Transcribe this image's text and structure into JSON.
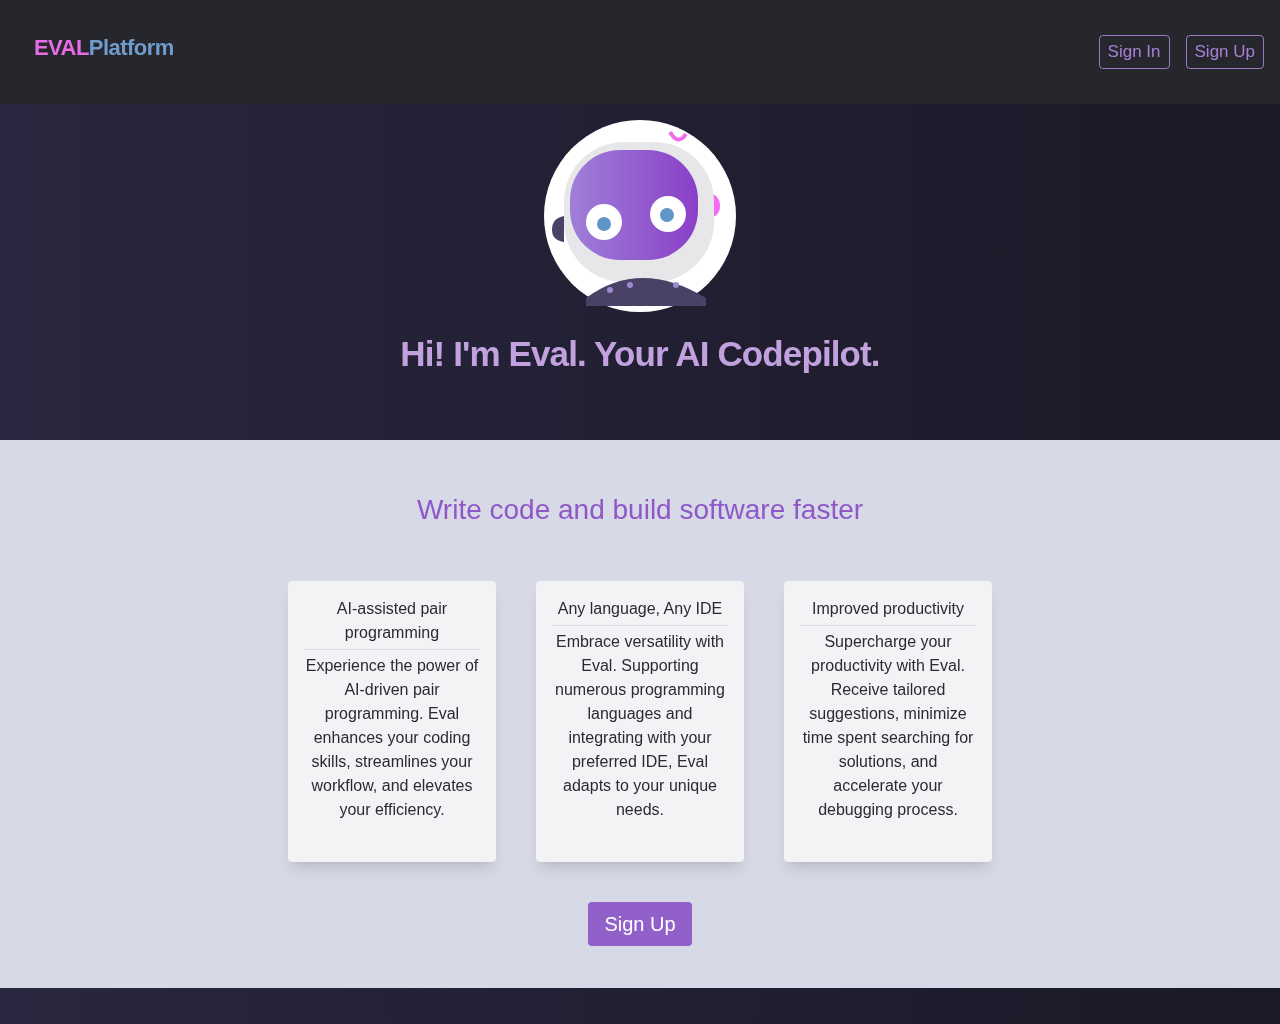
{
  "header": {
    "logo": {
      "part_1": "EVAL",
      "part_2": "Platform"
    },
    "buttons": [
      "Sign In",
      "Sign Up"
    ]
  },
  "hero": {
    "heading": "Hi! I'm Eval. Your AI Codepilot."
  },
  "features": {
    "subtitle": "Write code and build software faster",
    "cards": [
      {
        "title": "AI-assisted pair programming",
        "body": "Experience the power of AI-driven pair programming. Eval enhances your coding skills, streamlines your workflow, and elevates your efficiency."
      },
      {
        "title": "Any language, Any IDE",
        "body": "Embrace versatility with Eval. Supporting numerous programming languages and integrating with your preferred IDE, Eval adapts to your unique needs."
      },
      {
        "title": "Improved productivity",
        "body": "Supercharge your productivity with Eval. Receive tailored suggestions, minimize time spent searching for solutions, and accelerate your debugging process."
      }
    ],
    "cta": "Sign Up"
  }
}
